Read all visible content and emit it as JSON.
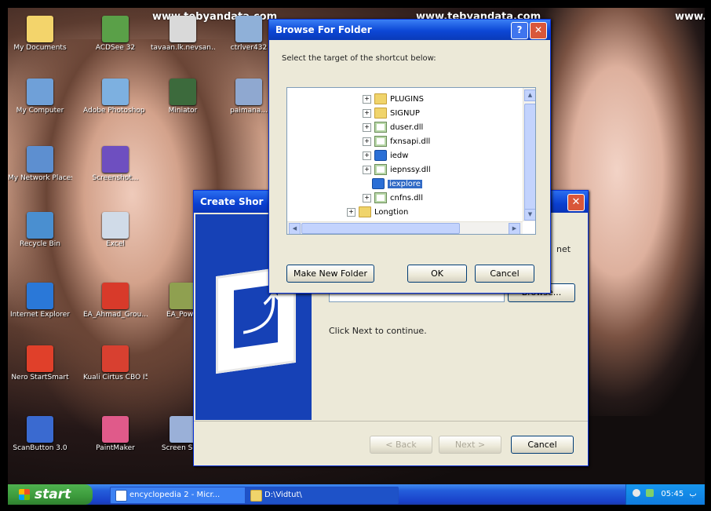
{
  "watermarks": [
    "www.tebyandata.com",
    "www.tebyandata.com",
    "www.t"
  ],
  "desktop_icons": [
    {
      "label": "My Documents",
      "icon": "folder-docs-icon",
      "color": "#f3d46b"
    },
    {
      "label": "ACDSee 32",
      "icon": "acdsee-icon",
      "color": "#5aa048"
    },
    {
      "label": "tavaan.lk.nevsan...",
      "icon": "pdf-icon",
      "color": "#d9d9d9"
    },
    {
      "label": "ctrlver432",
      "icon": "app-icon",
      "color": "#8fb0d8"
    },
    {
      "label": "My Computer",
      "icon": "computer-icon",
      "color": "#6fa0d8"
    },
    {
      "label": "Adobe Photoshop CS",
      "icon": "photoshop-icon",
      "color": "#7db0e0"
    },
    {
      "label": "Miniator",
      "icon": "miniator-icon",
      "color": "#3c6a3c"
    },
    {
      "label": "paimana...",
      "icon": "doc-icon",
      "color": "#8fa8d0"
    },
    {
      "label": "My Network Places",
      "icon": "network-icon",
      "color": "#5d8fd0"
    },
    {
      "label": "Screenshot...",
      "icon": "screenshot-icon",
      "color": "#6e4fc0"
    },
    {
      "label": "Recycle Bin",
      "icon": "recycle-bin-icon",
      "color": "#4a8fd0"
    },
    {
      "label": "Excel",
      "icon": "doc-icon",
      "color": "#d0dbe8"
    },
    {
      "label": "Internet Explorer",
      "icon": "ie-icon",
      "color": "#2a78d8"
    },
    {
      "label": "EA_Ahmad_Grou...",
      "icon": "shortcut-icon",
      "color": "#d83a2a"
    },
    {
      "label": "EA_Pow...",
      "icon": "shortcut-icon",
      "color": "#8fa050"
    },
    {
      "label": "Nero StartSmart",
      "icon": "nero-icon",
      "color": "#e0402a"
    },
    {
      "label": "Kuali Cirtus CBO I5",
      "icon": "shortcut-icon",
      "color": "#d84030"
    },
    {
      "label": "ScanButton 3.0",
      "icon": "scan-icon",
      "color": "#3a6ad0"
    },
    {
      "label": "PaintMaker",
      "icon": "paint-icon",
      "color": "#e05a8a"
    },
    {
      "label": "Screen Shot",
      "icon": "doc-icon",
      "color": "#9ab0d8"
    }
  ],
  "wizard": {
    "title": "Create Shor",
    "partial_text": "net",
    "location_value": "",
    "browse_label": "Browse...",
    "hint": "Click Next to continue.",
    "back_label": "< Back",
    "next_label": "Next >",
    "cancel_label": "Cancel",
    "close_glyph": "✕"
  },
  "browse_dialog": {
    "title": "Browse For Folder",
    "prompt": "Select the target of the shortcut below:",
    "help_glyph": "?",
    "close_glyph": "✕",
    "tree": [
      {
        "label": "PLUGINS",
        "type": "folder"
      },
      {
        "label": "SIGNUP",
        "type": "folder"
      },
      {
        "label": "duser.dll",
        "type": "dll"
      },
      {
        "label": "fxnsapi.dll",
        "type": "dll"
      },
      {
        "label": "iedw",
        "type": "exe"
      },
      {
        "label": "iepnssy.dll",
        "type": "dll"
      },
      {
        "label": "iexplore",
        "type": "exe",
        "selected": true
      },
      {
        "label": "cnfns.dll",
        "type": "dll"
      },
      {
        "label": "Longtion",
        "type": "folder"
      }
    ],
    "make_new_folder_label": "Make New Folder",
    "ok_label": "OK",
    "cancel_label": "Cancel"
  },
  "taskbar": {
    "start_label": "start",
    "tasks": [
      {
        "label": "encyclopedia 2 - Micr...",
        "icon": "word-doc-icon"
      },
      {
        "label": "D:\\Vidtut\\"
      }
    ],
    "tray_time": "05:45",
    "tray_lang": "ب"
  }
}
